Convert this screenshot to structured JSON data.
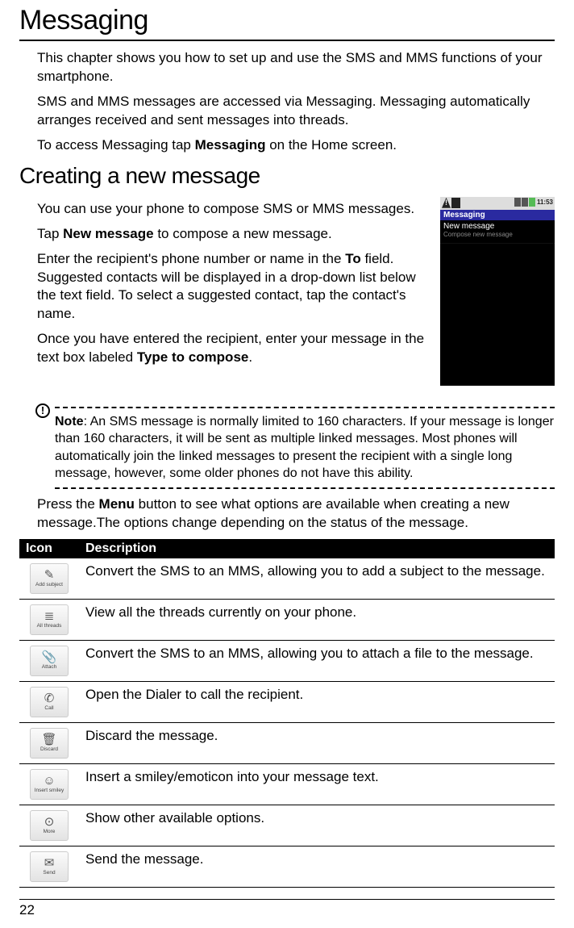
{
  "chapter_title": "Messaging",
  "intro": {
    "p1": "This chapter shows you how to set up and use the SMS and MMS functions of your smartphone.",
    "p2": "SMS and MMS messages are accessed via Messaging. Messaging automatically arranges received and sent messages into threads.",
    "p3_a": "To access Messaging tap ",
    "p3_bold": "Messaging",
    "p3_b": " on the Home screen."
  },
  "section_title": "Creating a new message",
  "create": {
    "p1": "You can use your phone to compose SMS or MMS messages.",
    "p2_a": "Tap ",
    "p2_bold": "New message",
    "p2_b": " to compose a new message.",
    "p3_a": "Enter the recipient's phone number or name in the ",
    "p3_bold": "To",
    "p3_b": " field. Suggested contacts will be displayed in a drop-down list below the text field. To select a suggested contact, tap the contact's name.",
    "p4_a": "Once you have entered the recipient, enter your message in the text box labeled ",
    "p4_bold": "Type to compose",
    "p4_b": "."
  },
  "screenshot": {
    "time": "11:53",
    "titlebar": "Messaging",
    "row_title": "New message",
    "row_sub": "Compose new message"
  },
  "note": {
    "label": "Note",
    "text": ": An SMS message is normally limited to 160 characters. If your message is longer than 160 characters, it will be sent as multiple linked messages. Most phones will automatically join the linked messages to present the recipient with a single long message, however, some older phones do not have this ability."
  },
  "after_note_a": "Press the ",
  "after_note_bold": "Menu",
  "after_note_b": " button to see what options are available when creating a new message.The options change depending on the status of the message.",
  "table": {
    "head_icon": "Icon",
    "head_desc": "Description",
    "rows": [
      {
        "icon_label": "Add subject",
        "glyph": "✎",
        "desc": "Convert the SMS to an MMS, allowing you to add a subject to the message."
      },
      {
        "icon_label": "All threads",
        "glyph": "≣",
        "desc": "View all the threads currently on your phone."
      },
      {
        "icon_label": "Attach",
        "glyph": "📎",
        "desc": "Convert the SMS to an MMS, allowing you to attach a file to the message."
      },
      {
        "icon_label": "Call",
        "glyph": "✆",
        "desc": "Open the Dialer to call the recipient."
      },
      {
        "icon_label": "Discard",
        "glyph": "🗑",
        "desc": "Discard the message."
      },
      {
        "icon_label": "Insert smiley",
        "glyph": "☺",
        "desc": "Insert a smiley/emoticon into your message text."
      },
      {
        "icon_label": "More",
        "glyph": "⊙",
        "desc": "Show other available options."
      },
      {
        "icon_label": "Send",
        "glyph": "✉",
        "desc": "Send the message."
      }
    ]
  },
  "page_number": "22"
}
